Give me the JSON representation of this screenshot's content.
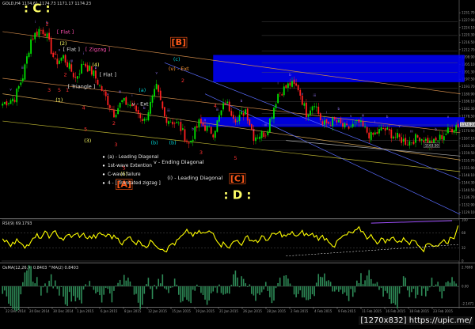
{
  "chart_data": {
    "type": "candlestick",
    "symbol_header": "GOLD,H4  1174.61  1174.73  1171.17  1174.23",
    "watermark": "[1270x832] https://upic.me/",
    "colors": {
      "bull": "#00e000",
      "bear": "#ff2020",
      "background": "#000000",
      "band": "#0000ff",
      "rsi": "#ffff00",
      "osma": "#2e8b57"
    },
    "price_axis": {
      "ylim": [
        1126,
        1235
      ],
      "ticks": [
        "1231.70",
        "1227.90",
        "1224.10",
        "1220.30",
        "1216.50",
        "1212.70",
        "1208.90",
        "1205.10",
        "1201.30",
        "1197.50",
        "1193.70",
        "1189.90",
        "1186.10",
        "1182.30",
        "1178.50",
        "1174.70",
        "1170.90",
        "1167.10",
        "1163.30",
        "1159.50",
        "1155.70",
        "1151.90",
        "1148.10",
        "1144.30",
        "1140.50",
        "1136.70",
        "1132.90",
        "1129.10"
      ],
      "current_price": "1174.23",
      "marked_price": "1163.50"
    },
    "close_series_anchors": [
      {
        "i": 0,
        "p": 1185
      },
      {
        "i": 6,
        "p": 1188
      },
      {
        "i": 10,
        "p": 1199
      },
      {
        "i": 14,
        "p": 1218
      },
      {
        "i": 18,
        "p": 1223
      },
      {
        "i": 21,
        "p": 1222
      },
      {
        "i": 26,
        "p": 1206
      },
      {
        "i": 30,
        "p": 1209
      },
      {
        "i": 36,
        "p": 1198
      },
      {
        "i": 40,
        "p": 1206
      },
      {
        "i": 45,
        "p": 1200
      },
      {
        "i": 51,
        "p": 1188
      },
      {
        "i": 55,
        "p": 1180
      },
      {
        "i": 59,
        "p": 1186
      },
      {
        "i": 64,
        "p": 1184
      },
      {
        "i": 70,
        "p": 1176
      },
      {
        "i": 76,
        "p": 1193
      },
      {
        "i": 80,
        "p": 1178
      },
      {
        "i": 87,
        "p": 1174
      },
      {
        "i": 92,
        "p": 1164
      },
      {
        "i": 97,
        "p": 1175
      },
      {
        "i": 104,
        "p": 1170
      },
      {
        "i": 110,
        "p": 1186
      },
      {
        "i": 116,
        "p": 1176
      },
      {
        "i": 120,
        "p": 1182
      },
      {
        "i": 124,
        "p": 1168
      },
      {
        "i": 130,
        "p": 1170
      },
      {
        "i": 136,
        "p": 1190
      },
      {
        "i": 142,
        "p": 1195
      },
      {
        "i": 146,
        "p": 1193
      },
      {
        "i": 150,
        "p": 1180
      },
      {
        "i": 154,
        "p": 1186
      },
      {
        "i": 158,
        "p": 1174
      },
      {
        "i": 164,
        "p": 1176
      },
      {
        "i": 170,
        "p": 1172
      },
      {
        "i": 176,
        "p": 1175
      },
      {
        "i": 182,
        "p": 1168
      },
      {
        "i": 188,
        "p": 1172
      },
      {
        "i": 194,
        "p": 1168
      },
      {
        "i": 200,
        "p": 1165
      },
      {
        "i": 206,
        "p": 1168
      },
      {
        "i": 212,
        "p": 1164
      },
      {
        "i": 218,
        "p": 1169
      },
      {
        "i": 224,
        "p": 1174
      }
    ],
    "wave_labels": [
      {
        "text": ": C :",
        "i": 17,
        "p": 1232,
        "color": "#ffff66",
        "size": "xl"
      },
      {
        "text": "2",
        "i": 22,
        "p": 1225,
        "color": "#ff3030"
      },
      {
        "text": "[ Flat ]",
        "i": 31,
        "p": 1221,
        "color": "#ff4fb0"
      },
      {
        "text": "(2)",
        "i": 30,
        "p": 1215,
        "color": "#ffff66"
      },
      {
        "text": "[ Flat ]",
        "i": 34,
        "p": 1212,
        "color": "#e0e0e0"
      },
      {
        "text": "4",
        "i": 26,
        "p": 1210,
        "color": "#ff3030"
      },
      {
        "text": "[ Zigzag ]",
        "i": 47,
        "p": 1212,
        "color": "#ff4fb0"
      },
      {
        "text": "(4)",
        "i": 46,
        "p": 1204,
        "color": "#ffff66"
      },
      {
        "text": "[ Flat ]",
        "i": 52,
        "p": 1199,
        "color": "#e0e0e0"
      },
      {
        "text": "2",
        "i": 31,
        "p": 1199,
        "color": "#ff3030"
      },
      {
        "text": "[ Triangle ]",
        "i": 39,
        "p": 1193,
        "color": "#e0e0e0"
      },
      {
        "text": "3",
        "i": 23,
        "p": 1191,
        "color": "#ff3030"
      },
      {
        "text": "5",
        "i": 28,
        "p": 1191,
        "color": "#ff3030"
      },
      {
        "text": "1",
        "i": 32,
        "p": 1191,
        "color": "#ff3030"
      },
      {
        "text": "(1)",
        "i": 28,
        "p": 1186,
        "color": "#ffff66"
      },
      {
        "text": "4",
        "i": 40,
        "p": 1182,
        "color": "#ff3030"
      },
      {
        "text": "5",
        "i": 41,
        "p": 1171,
        "color": "#ff3030"
      },
      {
        "text": "2",
        "i": 55,
        "p": 1174,
        "color": "#ff3030"
      },
      {
        "text": "(3)",
        "i": 42,
        "p": 1165,
        "color": "#ffff66"
      },
      {
        "text": "3",
        "i": 56,
        "p": 1163,
        "color": "#ff3030"
      },
      {
        "text": "5",
        "i": 60,
        "p": 1151,
        "color": "#ff3030"
      },
      {
        "text": "(5)",
        "i": 60,
        "p": 1148,
        "color": "#ffff66"
      },
      {
        "text": "[A]",
        "i": 60,
        "p": 1142,
        "color": "#ff5a1a",
        "size": "lg"
      },
      {
        "text": "(a)",
        "i": 69,
        "p": 1191,
        "color": "#00d0d0"
      },
      {
        "text": "v - Ext",
        "i": 68,
        "p": 1184,
        "color": "#e8e8e8"
      },
      {
        "text": "(b)",
        "i": 75,
        "p": 1164,
        "color": "#00d0d0"
      },
      {
        "text": "[B]",
        "i": 87,
        "p": 1215,
        "color": "#ff5a1a",
        "size": "lg"
      },
      {
        "text": "(c)",
        "i": 86,
        "p": 1207,
        "color": "#00d0d0"
      },
      {
        "text": "(v) - Ext",
        "i": 87,
        "p": 1202,
        "color": "#ff9933"
      },
      {
        "text": "2",
        "i": 89,
        "p": 1196,
        "color": "#ff3030"
      },
      {
        "text": "(b)",
        "i": 84,
        "p": 1164,
        "color": "#00d0d0"
      },
      {
        "text": "4",
        "i": 105,
        "p": 1183,
        "color": "#ff3030"
      },
      {
        "text": "v - Ending Diagonal",
        "i": 87,
        "p": 1154,
        "color": "#e8e8e8"
      },
      {
        "text": "(i) - Leading Diagonal",
        "i": 95,
        "p": 1146,
        "color": "#e8e8e8"
      },
      {
        "text": "3",
        "i": 98,
        "p": 1159,
        "color": "#ff3030"
      },
      {
        "text": "5",
        "i": 115,
        "p": 1156,
        "color": "#ff3030"
      },
      {
        "text": "[C]",
        "i": 116,
        "p": 1145,
        "color": "#ff5a1a",
        "size": "lg"
      },
      {
        "text": ": D :",
        "i": 116,
        "p": 1136,
        "color": "#ffff66",
        "size": "xl"
      }
    ],
    "legend_notes": [
      "(a) - Leading Diagonal",
      "1st-wave Extention",
      "C-wave failure",
      "4 - [ Truncated zigzag ]"
    ],
    "indicators": [
      {
        "name": "RSI(9) 69.1793",
        "levels": [
          100,
          68,
          32,
          0
        ],
        "color": "#ffff00"
      },
      {
        "name": "OsMA(12,26,9) 0.8403  ^MA(2) 0.8403",
        "levels": [
          "2.7698",
          "0.00",
          "-2.1471"
        ],
        "color": "#2e8b57"
      }
    ],
    "timestamp_axis": [
      "22 Dec 2014",
      "24 Dec 2014",
      "30 Dec 2014",
      "1 Jan 2015",
      "6 Jan 2015",
      "8 Jan 2015",
      "12 Jan 2015",
      "15 Jan 2015",
      "19 Jan 2015",
      "21 Jan 2015",
      "26 Jan 2015",
      "28 Jan 2015",
      "2 Feb 2015",
      "4 Feb 2015",
      "9 Feb 2015",
      "11 Feb 2015",
      "16 Feb 2015",
      "18 Feb 2015",
      "23 Feb 2015"
    ]
  }
}
